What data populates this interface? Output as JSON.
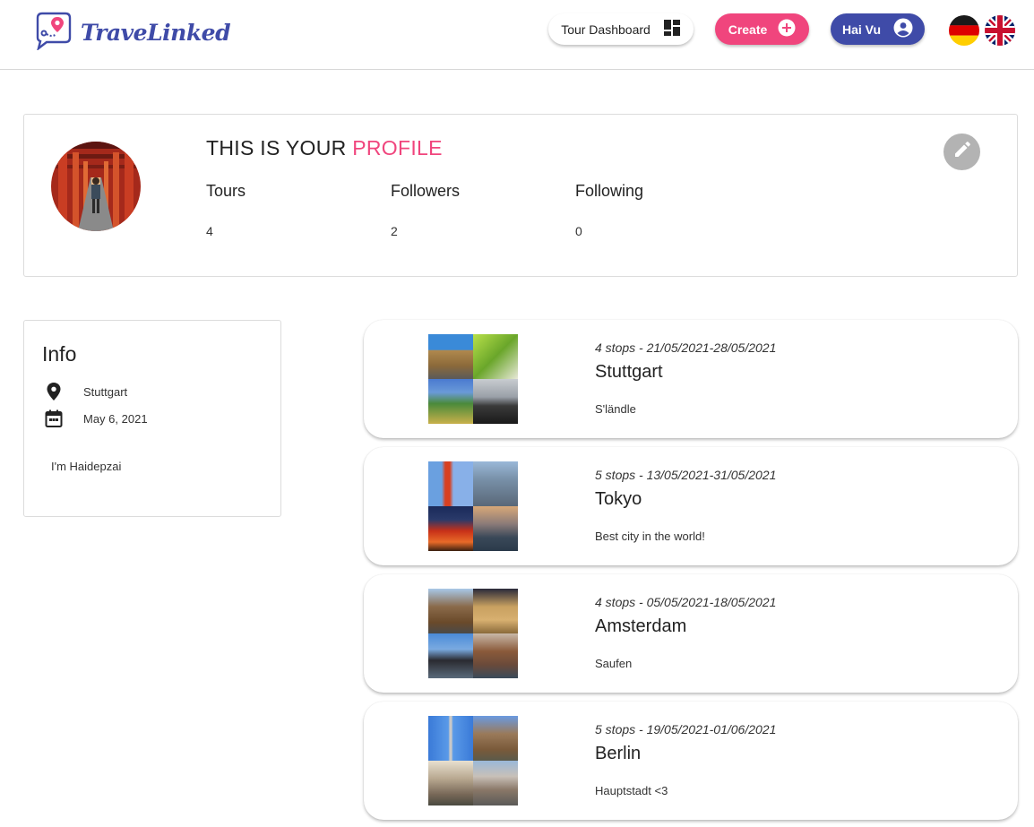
{
  "header": {
    "logo_text": "TraveLinked",
    "dashboard_label": "Tour Dashboard",
    "create_label": "Create",
    "user_label": "Hai Vu"
  },
  "profile": {
    "title_prefix": "THIS IS YOUR ",
    "title_accent": "PROFILE",
    "stats": [
      {
        "label": "Tours",
        "value": "4"
      },
      {
        "label": "Followers",
        "value": "2"
      },
      {
        "label": "Following",
        "value": "0"
      }
    ]
  },
  "info": {
    "title": "Info",
    "location": "Stuttgart",
    "date": "May 6, 2021",
    "bio": "I'm Haidepzai"
  },
  "tours": [
    {
      "meta": "4 stops - 21/05/2021-28/05/2021",
      "name": "Stuttgart",
      "desc": "S'ländle"
    },
    {
      "meta": "5 stops - 13/05/2021-31/05/2021",
      "name": "Tokyo",
      "desc": "Best city in the world!"
    },
    {
      "meta": "4 stops - 05/05/2021-18/05/2021",
      "name": "Amsterdam",
      "desc": "Saufen"
    },
    {
      "meta": "5 stops - 19/05/2021-01/06/2021",
      "name": "Berlin",
      "desc": "Hauptstadt <3"
    }
  ],
  "colors": {
    "brand_blue": "#3f4ba8",
    "accent_pink": "#f0457d",
    "edit_grey": "#b3b3b3"
  }
}
